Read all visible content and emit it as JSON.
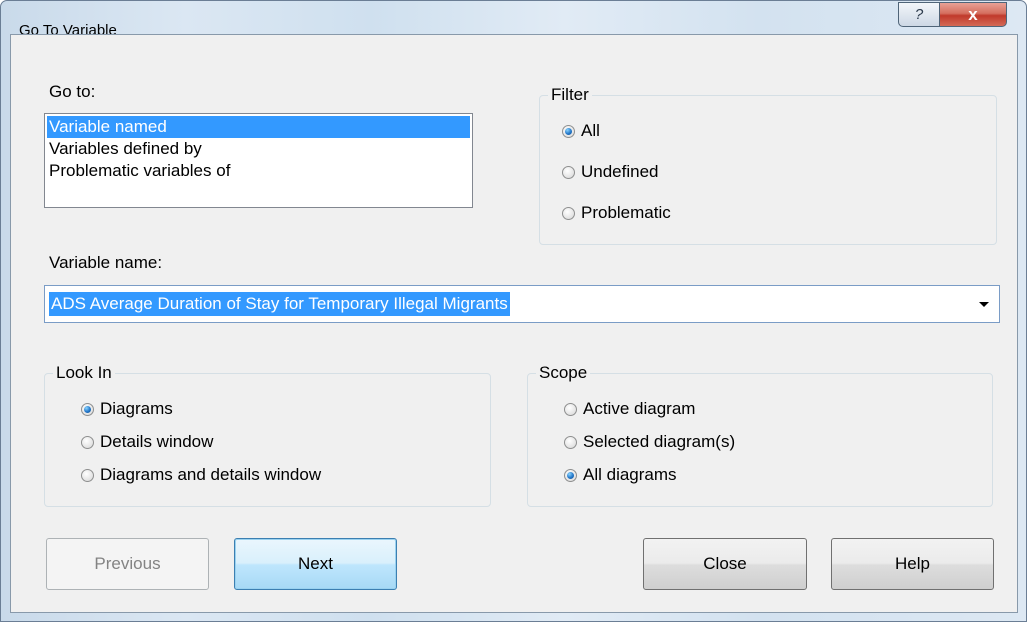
{
  "window": {
    "title": "Go To Variable",
    "help_glyph": "?",
    "close_glyph": "x"
  },
  "goto": {
    "label": "Go to:",
    "items": [
      "Variable named",
      "Variables defined by",
      "Problematic variables of"
    ],
    "selected_index": 0
  },
  "filter": {
    "title": "Filter",
    "options": [
      "All",
      "Undefined",
      "Problematic"
    ],
    "selected_index": 0
  },
  "variable_name": {
    "label": "Variable name:",
    "value": "ADS Average Duration of Stay for Temporary Illegal Migrants"
  },
  "look_in": {
    "title": "Look In",
    "options": [
      "Diagrams",
      "Details window",
      "Diagrams and details window"
    ],
    "selected_index": 0
  },
  "scope": {
    "title": "Scope",
    "options": [
      "Active diagram",
      "Selected diagram(s)",
      "All diagrams"
    ],
    "selected_index": 2
  },
  "buttons": {
    "previous": "Previous",
    "next": "Next",
    "close": "Close",
    "help": "Help"
  },
  "colors": {
    "selection": "#3399ff",
    "dialog_face": "#f0f0f0",
    "close_button": "#c0392b"
  }
}
